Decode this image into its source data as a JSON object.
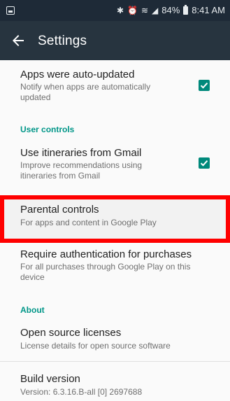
{
  "status_bar": {
    "icons": [
      "notification-icon",
      "bluetooth-icon",
      "alarm-icon",
      "wifi-icon",
      "signal-icon",
      "battery-icon"
    ],
    "battery": "84%",
    "time": "8:41 AM"
  },
  "toolbar": {
    "title": "Settings"
  },
  "items": {
    "auto_updated": {
      "title": "Apps were auto-updated",
      "subtitle": "Notify when apps are automatically updated",
      "checked": true
    },
    "itineraries": {
      "title": "Use itineraries from Gmail",
      "subtitle": "Improve recommendations using itineraries from Gmail",
      "checked": true
    },
    "parental": {
      "title": "Parental controls",
      "subtitle": "For apps and content in Google Play"
    },
    "auth": {
      "title": "Require authentication for purchases",
      "subtitle": "For all purchases through Google Play on this device"
    },
    "licenses": {
      "title": "Open source licenses",
      "subtitle": "License details for open source software"
    },
    "build": {
      "title": "Build version",
      "subtitle": "Version: 6.3.16.B-all [0] 2697688"
    }
  },
  "sections": {
    "user_controls": "User controls",
    "about": "About"
  },
  "colors": {
    "accent": "#009688",
    "highlight_border": "#ff0000",
    "toolbar": "#27343f",
    "status_bar": "#1e2a37"
  }
}
